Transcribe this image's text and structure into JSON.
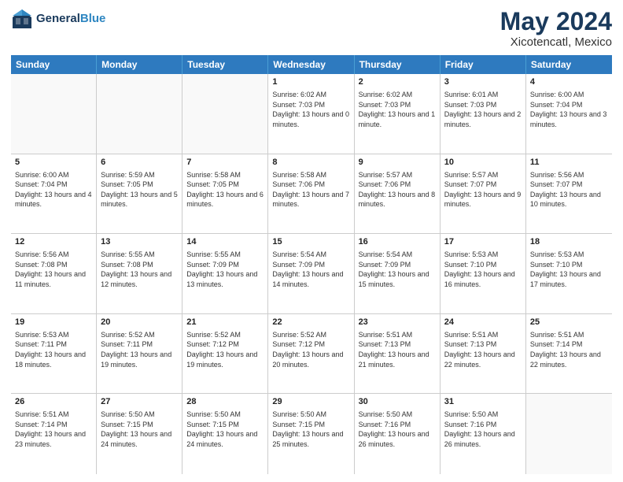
{
  "header": {
    "logo_line1": "General",
    "logo_line2": "Blue",
    "month": "May 2024",
    "location": "Xicotencatl, Mexico"
  },
  "weekdays": [
    "Sunday",
    "Monday",
    "Tuesday",
    "Wednesday",
    "Thursday",
    "Friday",
    "Saturday"
  ],
  "weeks": [
    [
      {
        "day": "",
        "sunrise": "",
        "sunset": "",
        "daylight": ""
      },
      {
        "day": "",
        "sunrise": "",
        "sunset": "",
        "daylight": ""
      },
      {
        "day": "",
        "sunrise": "",
        "sunset": "",
        "daylight": ""
      },
      {
        "day": "1",
        "sunrise": "Sunrise: 6:02 AM",
        "sunset": "Sunset: 7:03 PM",
        "daylight": "Daylight: 13 hours and 0 minutes."
      },
      {
        "day": "2",
        "sunrise": "Sunrise: 6:02 AM",
        "sunset": "Sunset: 7:03 PM",
        "daylight": "Daylight: 13 hours and 1 minute."
      },
      {
        "day": "3",
        "sunrise": "Sunrise: 6:01 AM",
        "sunset": "Sunset: 7:03 PM",
        "daylight": "Daylight: 13 hours and 2 minutes."
      },
      {
        "day": "4",
        "sunrise": "Sunrise: 6:00 AM",
        "sunset": "Sunset: 7:04 PM",
        "daylight": "Daylight: 13 hours and 3 minutes."
      }
    ],
    [
      {
        "day": "5",
        "sunrise": "Sunrise: 6:00 AM",
        "sunset": "Sunset: 7:04 PM",
        "daylight": "Daylight: 13 hours and 4 minutes."
      },
      {
        "day": "6",
        "sunrise": "Sunrise: 5:59 AM",
        "sunset": "Sunset: 7:05 PM",
        "daylight": "Daylight: 13 hours and 5 minutes."
      },
      {
        "day": "7",
        "sunrise": "Sunrise: 5:58 AM",
        "sunset": "Sunset: 7:05 PM",
        "daylight": "Daylight: 13 hours and 6 minutes."
      },
      {
        "day": "8",
        "sunrise": "Sunrise: 5:58 AM",
        "sunset": "Sunset: 7:06 PM",
        "daylight": "Daylight: 13 hours and 7 minutes."
      },
      {
        "day": "9",
        "sunrise": "Sunrise: 5:57 AM",
        "sunset": "Sunset: 7:06 PM",
        "daylight": "Daylight: 13 hours and 8 minutes."
      },
      {
        "day": "10",
        "sunrise": "Sunrise: 5:57 AM",
        "sunset": "Sunset: 7:07 PM",
        "daylight": "Daylight: 13 hours and 9 minutes."
      },
      {
        "day": "11",
        "sunrise": "Sunrise: 5:56 AM",
        "sunset": "Sunset: 7:07 PM",
        "daylight": "Daylight: 13 hours and 10 minutes."
      }
    ],
    [
      {
        "day": "12",
        "sunrise": "Sunrise: 5:56 AM",
        "sunset": "Sunset: 7:08 PM",
        "daylight": "Daylight: 13 hours and 11 minutes."
      },
      {
        "day": "13",
        "sunrise": "Sunrise: 5:55 AM",
        "sunset": "Sunset: 7:08 PM",
        "daylight": "Daylight: 13 hours and 12 minutes."
      },
      {
        "day": "14",
        "sunrise": "Sunrise: 5:55 AM",
        "sunset": "Sunset: 7:09 PM",
        "daylight": "Daylight: 13 hours and 13 minutes."
      },
      {
        "day": "15",
        "sunrise": "Sunrise: 5:54 AM",
        "sunset": "Sunset: 7:09 PM",
        "daylight": "Daylight: 13 hours and 14 minutes."
      },
      {
        "day": "16",
        "sunrise": "Sunrise: 5:54 AM",
        "sunset": "Sunset: 7:09 PM",
        "daylight": "Daylight: 13 hours and 15 minutes."
      },
      {
        "day": "17",
        "sunrise": "Sunrise: 5:53 AM",
        "sunset": "Sunset: 7:10 PM",
        "daylight": "Daylight: 13 hours and 16 minutes."
      },
      {
        "day": "18",
        "sunrise": "Sunrise: 5:53 AM",
        "sunset": "Sunset: 7:10 PM",
        "daylight": "Daylight: 13 hours and 17 minutes."
      }
    ],
    [
      {
        "day": "19",
        "sunrise": "Sunrise: 5:53 AM",
        "sunset": "Sunset: 7:11 PM",
        "daylight": "Daylight: 13 hours and 18 minutes."
      },
      {
        "day": "20",
        "sunrise": "Sunrise: 5:52 AM",
        "sunset": "Sunset: 7:11 PM",
        "daylight": "Daylight: 13 hours and 19 minutes."
      },
      {
        "day": "21",
        "sunrise": "Sunrise: 5:52 AM",
        "sunset": "Sunset: 7:12 PM",
        "daylight": "Daylight: 13 hours and 19 minutes."
      },
      {
        "day": "22",
        "sunrise": "Sunrise: 5:52 AM",
        "sunset": "Sunset: 7:12 PM",
        "daylight": "Daylight: 13 hours and 20 minutes."
      },
      {
        "day": "23",
        "sunrise": "Sunrise: 5:51 AM",
        "sunset": "Sunset: 7:13 PM",
        "daylight": "Daylight: 13 hours and 21 minutes."
      },
      {
        "day": "24",
        "sunrise": "Sunrise: 5:51 AM",
        "sunset": "Sunset: 7:13 PM",
        "daylight": "Daylight: 13 hours and 22 minutes."
      },
      {
        "day": "25",
        "sunrise": "Sunrise: 5:51 AM",
        "sunset": "Sunset: 7:14 PM",
        "daylight": "Daylight: 13 hours and 22 minutes."
      }
    ],
    [
      {
        "day": "26",
        "sunrise": "Sunrise: 5:51 AM",
        "sunset": "Sunset: 7:14 PM",
        "daylight": "Daylight: 13 hours and 23 minutes."
      },
      {
        "day": "27",
        "sunrise": "Sunrise: 5:50 AM",
        "sunset": "Sunset: 7:15 PM",
        "daylight": "Daylight: 13 hours and 24 minutes."
      },
      {
        "day": "28",
        "sunrise": "Sunrise: 5:50 AM",
        "sunset": "Sunset: 7:15 PM",
        "daylight": "Daylight: 13 hours and 24 minutes."
      },
      {
        "day": "29",
        "sunrise": "Sunrise: 5:50 AM",
        "sunset": "Sunset: 7:15 PM",
        "daylight": "Daylight: 13 hours and 25 minutes."
      },
      {
        "day": "30",
        "sunrise": "Sunrise: 5:50 AM",
        "sunset": "Sunset: 7:16 PM",
        "daylight": "Daylight: 13 hours and 26 minutes."
      },
      {
        "day": "31",
        "sunrise": "Sunrise: 5:50 AM",
        "sunset": "Sunset: 7:16 PM",
        "daylight": "Daylight: 13 hours and 26 minutes."
      },
      {
        "day": "",
        "sunrise": "",
        "sunset": "",
        "daylight": ""
      }
    ]
  ]
}
